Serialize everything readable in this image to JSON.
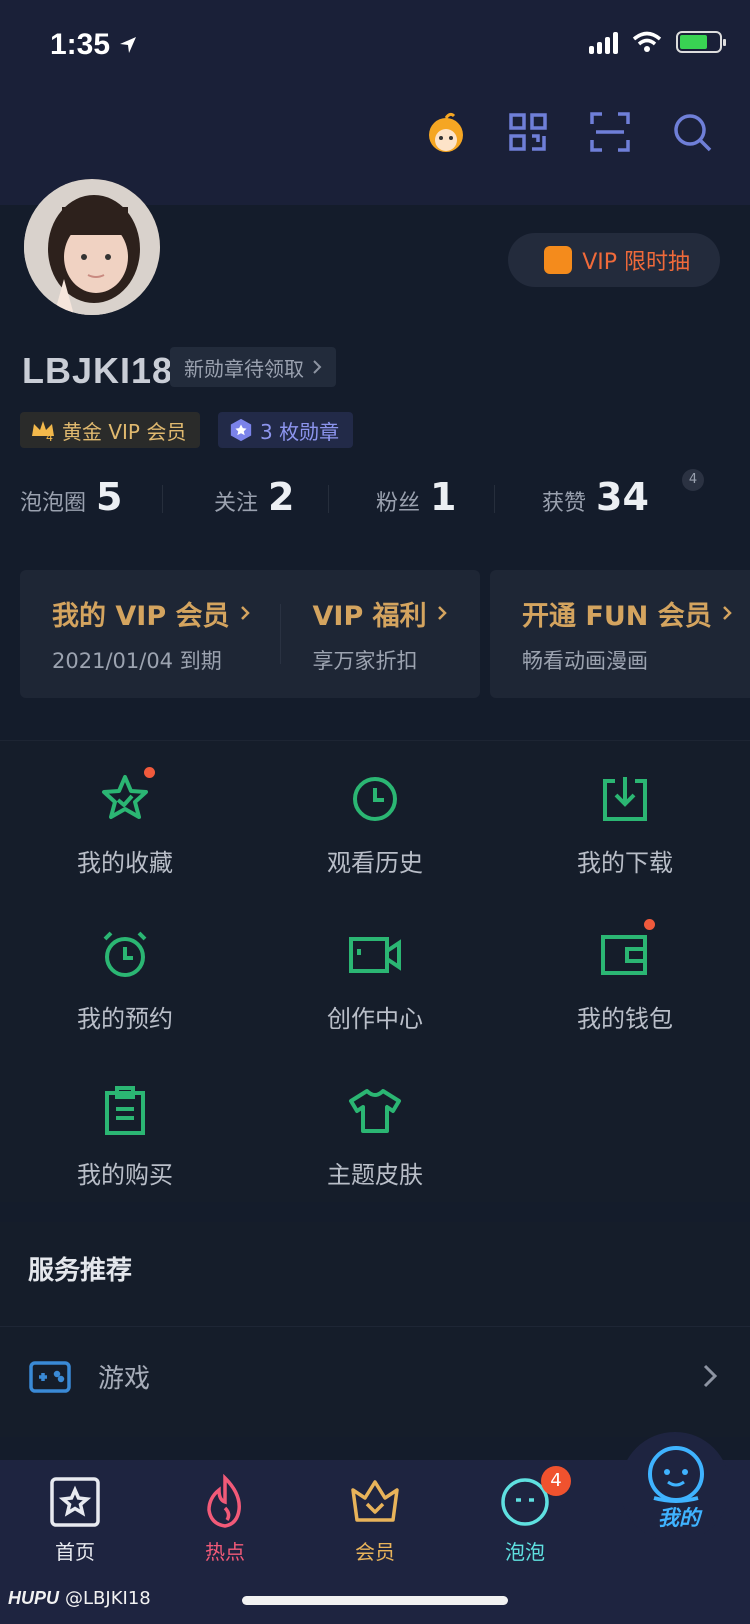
{
  "status": {
    "time": "1:35"
  },
  "profile": {
    "username": "LBJKI18",
    "badge_claim": "新勋章待领取",
    "vip_lottery": "VIP 限时抽",
    "tags": {
      "gold_vip": "黄金 VIP 会员",
      "gold_level": "4",
      "medals": "3 枚勋章"
    }
  },
  "stats": [
    {
      "label": "泡泡圈",
      "value": "5"
    },
    {
      "label": "关注",
      "value": "2"
    },
    {
      "label": "粉丝",
      "value": "1"
    },
    {
      "label": "获赞",
      "value": "34",
      "sup": "4"
    }
  ],
  "vip_cards": {
    "my_vip": {
      "title": "我的 VIP 会员",
      "sub": "2021/01/04 到期"
    },
    "vip_benefit": {
      "title": "VIP 福利",
      "sub": "享万家折扣"
    },
    "fun_member": {
      "title": "开通 FUN 会员",
      "sub": "畅看动画漫画"
    }
  },
  "grid": [
    {
      "label": "我的收藏",
      "icon": "star-icon",
      "dot": true
    },
    {
      "label": "观看历史",
      "icon": "clock-icon"
    },
    {
      "label": "我的下载",
      "icon": "download-icon"
    },
    {
      "label": "我的预约",
      "icon": "alarm-clock-icon"
    },
    {
      "label": "创作中心",
      "icon": "video-camera-icon"
    },
    {
      "label": "我的钱包",
      "icon": "wallet-icon",
      "dot": true
    },
    {
      "label": "我的购买",
      "icon": "clipboard-icon"
    },
    {
      "label": "主题皮肤",
      "icon": "tshirt-icon"
    }
  ],
  "services": {
    "title": "服务推荐",
    "items": [
      {
        "label": "游戏",
        "icon": "gamepad-icon"
      }
    ]
  },
  "tabs": [
    {
      "label": "首页",
      "color": "#e8eaf0"
    },
    {
      "label": "热点",
      "color": "#f25a78"
    },
    {
      "label": "会员",
      "color": "#e8b35a"
    },
    {
      "label": "泡泡",
      "color": "#5fe0e0",
      "badge": "4"
    },
    {
      "label": "我的",
      "color": "#3fb3ff"
    }
  ],
  "watermark": {
    "brand": "HUPU",
    "handle": "@LBJKI18"
  }
}
